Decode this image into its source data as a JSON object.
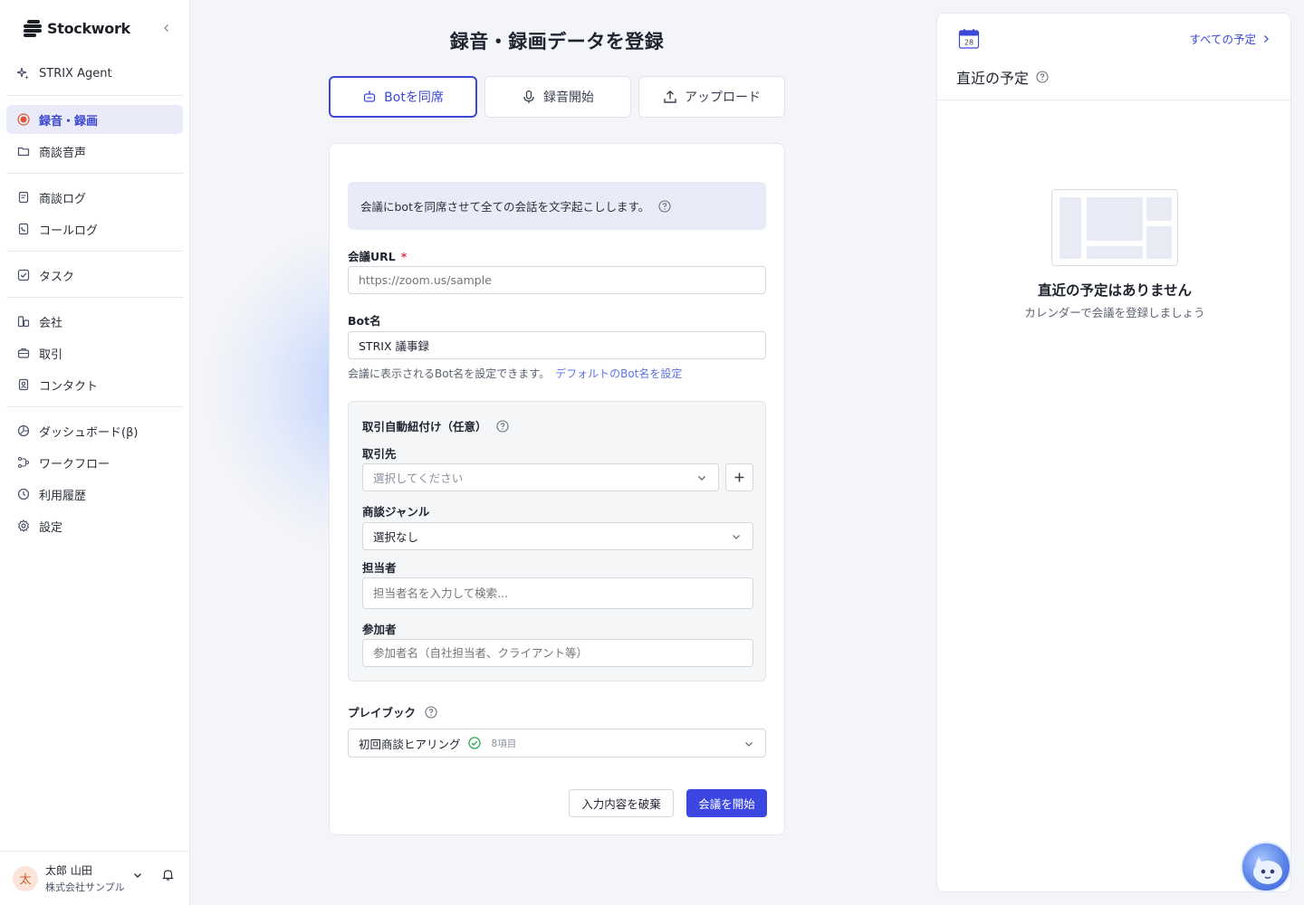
{
  "app": {
    "logo_text": "Stockwork"
  },
  "sidebar": {
    "items": [
      {
        "label": "STRIX Agent",
        "icon": "sparkle-icon"
      },
      {
        "label": "録音・録画",
        "icon": "record-icon",
        "active": true
      },
      {
        "label": "商談音声",
        "icon": "folder-icon"
      },
      {
        "label": "商談ログ",
        "icon": "document-icon"
      },
      {
        "label": "コールログ",
        "icon": "phone-log-icon"
      },
      {
        "label": "タスク",
        "icon": "checkbox-icon"
      },
      {
        "label": "会社",
        "icon": "building-icon"
      },
      {
        "label": "取引",
        "icon": "briefcase-icon"
      },
      {
        "label": "コンタクト",
        "icon": "contact-icon"
      },
      {
        "label": "ダッシュボード(β)",
        "icon": "dashboard-icon"
      },
      {
        "label": "ワークフロー",
        "icon": "workflow-icon"
      },
      {
        "label": "利用履歴",
        "icon": "clock-icon"
      },
      {
        "label": "設定",
        "icon": "gear-icon"
      }
    ],
    "user": {
      "avatar": "太",
      "name": "太郎 山田",
      "company": "株式会社サンプル"
    }
  },
  "main": {
    "title": "録音・録画データを登録",
    "tabs": [
      {
        "label": "Botを同席",
        "active": true
      },
      {
        "label": "録音開始"
      },
      {
        "label": "アップロード"
      }
    ],
    "info": "会議にbotを同席させて全ての会話を文字起こしします。",
    "meeting_url": {
      "label": "会議URL",
      "required_mark": "*",
      "placeholder": "https://zoom.us/sample",
      "value": ""
    },
    "bot_name": {
      "label": "Bot名",
      "value": "STRIX 議事録",
      "hint": "会議に表示されるBot名を設定できます。",
      "hint_link": "デフォルトのBot名を設定"
    },
    "deal_section": {
      "title": "取引自動紐付け（任意）",
      "client": {
        "label": "取引先",
        "placeholder": "選択してください"
      },
      "genre": {
        "label": "商談ジャンル",
        "value": "選択なし"
      },
      "owner": {
        "label": "担当者",
        "placeholder": "担当者名を入力して検索..."
      },
      "participants": {
        "label": "参加者",
        "placeholder": "参加者名（自社担当者、クライアント等）"
      }
    },
    "playbook": {
      "label": "プレイブック",
      "value": "初回商談ヒアリング",
      "count": "8項目"
    },
    "buttons": {
      "discard": "入力内容を破棄",
      "start": "会議を開始"
    }
  },
  "right_panel": {
    "calendar_day": "28",
    "all_link": "すべての予定",
    "title": "直近の予定",
    "empty_title": "直近の予定はありません",
    "empty_sub": "カレンダーで会議を登録しましょう"
  },
  "colors": {
    "accent": "#3b47e0",
    "active_bg": "#e9ebf9",
    "record_dot": "#e0553a"
  }
}
